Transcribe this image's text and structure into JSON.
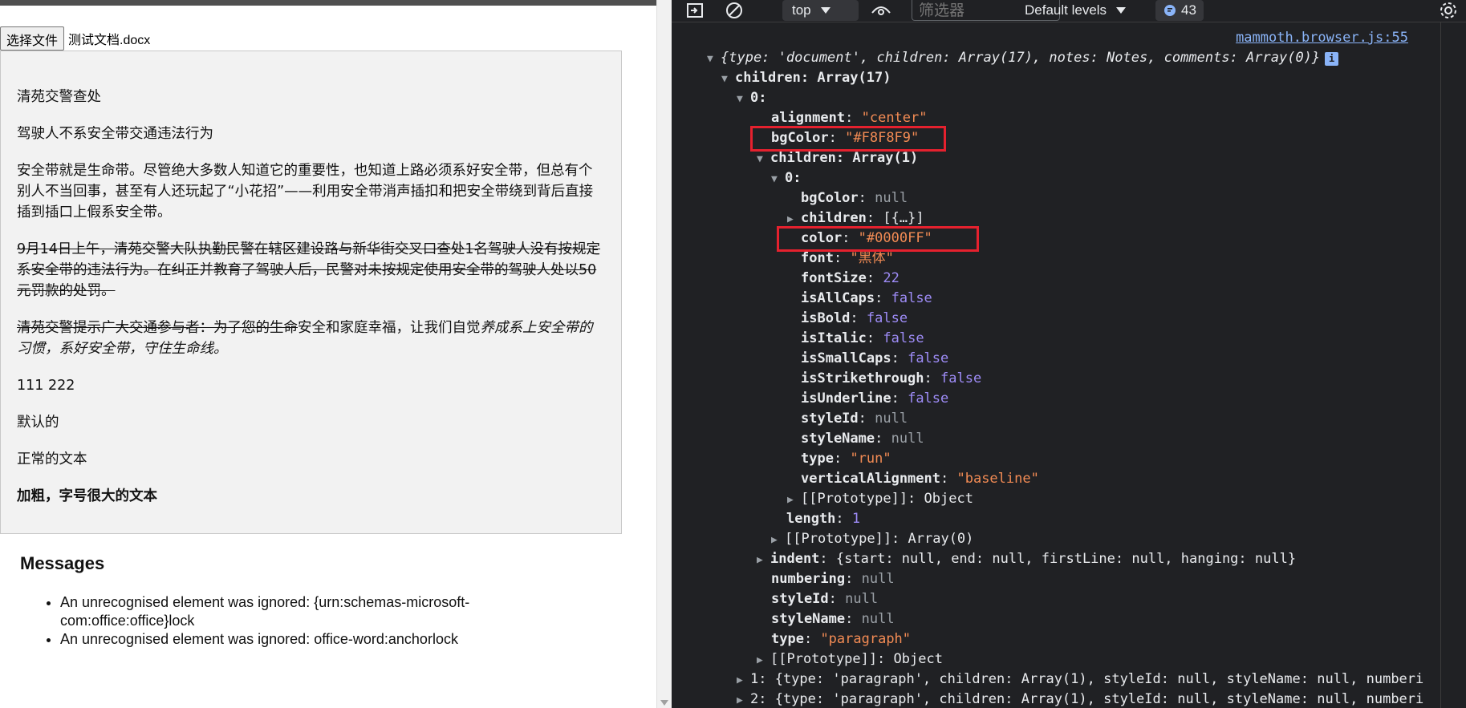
{
  "left": {
    "file_button": "选择文件",
    "file_name": "测试文档.docx",
    "paragraphs": {
      "p1": "清苑交警查处",
      "p2": "驾驶人不系安全带交通违法行为",
      "p3": "安全带就是生命带。尽管绝大多数人知道它的重要性，也知道上路必须系好安全带，但总有个别人不当回事，甚至有人还玩起了“小花招”——利用安全带消声插扣和把安全带绕到背后直接插到插口上假系安全带。",
      "p4": "9月14日上午，清苑交警大队执勤民警在辖区建设路与新华街交叉口查处1名驾驶人没有按规定系安全带的违法行为。在纠正并教育了驾驶人后，民警对未按规定使用安全带的驾驶人处以50元罚款的处罚。",
      "p5_strike": "清苑交警提示广大交通参与者：为了您的生命",
      "p5_normal": "安全和家庭幸福，让我们自觉",
      "p5_italic": "养成系上安全带的习惯，系好安全带，守住生命线。",
      "p6": "111 222",
      "p7": "默认的",
      "p8": "正常的文本",
      "p9": "加粗，字号很大的文本"
    },
    "messages_title": "Messages",
    "messages": [
      "An unrecognised element was ignored: {urn:schemas-microsoft-com:office:office}lock",
      "An unrecognised element was ignored: office-word:anchorlock"
    ]
  },
  "devtools": {
    "context": "top",
    "filter_placeholder": "筛选器",
    "levels": "Default levels",
    "issues_count": "43",
    "source_link": "mammoth.browser.js:55",
    "summary": "{type: 'document', children: Array(17), notes: Notes, comments: Array(0)}",
    "children_label": "children: Array(17)",
    "zero": "0:",
    "alignment_val": "\"center\"",
    "bgColor_val": "\"#F8F8F9\"",
    "children1": "children: Array(1)",
    "run_bgColor": "null",
    "run_children": "[{…}]",
    "run_color": "\"#0000FF\"",
    "run_font": "\"黑体\"",
    "run_fontSize": "22",
    "false_val": "false",
    "null_val": "null",
    "run_type": "\"run\"",
    "run_valign": "\"baseline\"",
    "proto_object": "[[Prototype]]: Object",
    "length_val": "1",
    "proto_array": "[[Prototype]]: Array(0)",
    "indent_val": "{start: null, end: null, firstLine: null, hanging: null}",
    "para_type": "\"paragraph\"",
    "row1": "1: {type: 'paragraph', children: Array(1), styleId: null, styleName: null, numberi",
    "row2": "2: {type: 'paragraph', children: Array(1), styleId: null, styleName: null, numberi"
  }
}
